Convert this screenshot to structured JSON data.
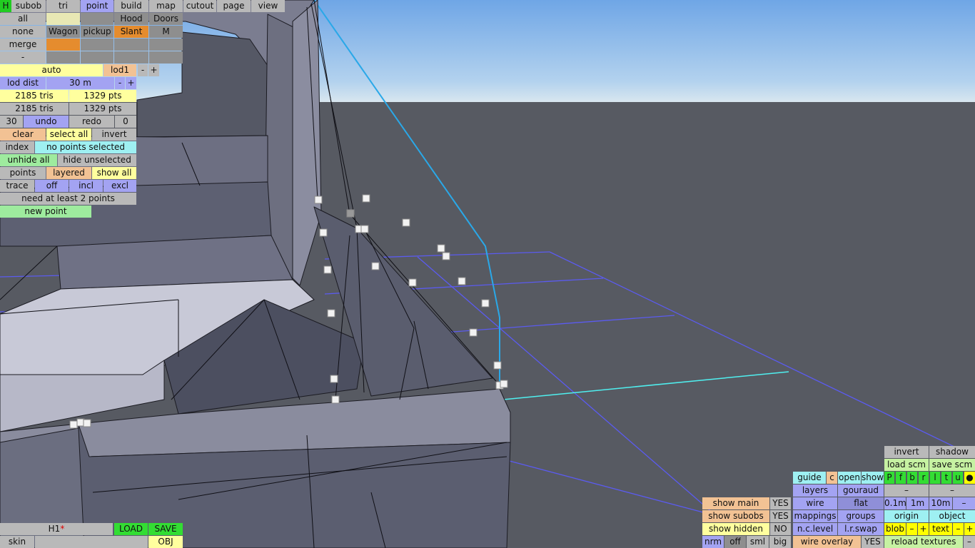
{
  "menu": {
    "h_button": "H",
    "tabs": [
      "subob",
      "tri",
      "point",
      "build",
      "map",
      "cutout",
      "page",
      "view"
    ],
    "active_tab": "point"
  },
  "selection_grid": {
    "row1": [
      "all",
      "",
      "",
      "Hood",
      "Doors"
    ],
    "row2": [
      "none",
      "Wagon",
      "pickup",
      "Slant",
      "M"
    ],
    "row3": [
      "merge",
      "",
      "",
      "",
      ""
    ],
    "row4": [
      "-",
      "",
      "",
      "",
      ""
    ]
  },
  "lod": {
    "mode": "auto",
    "level": "lod1",
    "minus": "-",
    "plus": "+",
    "dist_label": "lod dist",
    "dist_value": "30 m"
  },
  "stats": {
    "tris1": "2185 tris",
    "pts1": "1329 pts",
    "tris2": "2185 tris",
    "pts2": "1329 pts"
  },
  "undo": {
    "count": "30",
    "undo": "undo",
    "redo": "redo",
    "redo_count": "0"
  },
  "select_row": {
    "clear": "clear",
    "select_all": "select all",
    "invert": "invert"
  },
  "index_row": {
    "index": "index",
    "status": "no points selected"
  },
  "hide_row": {
    "unhide_all": "unhide all",
    "hide_unselected": "hide unselected"
  },
  "points_row": {
    "points": "points",
    "layered": "layered",
    "show_all": "show all"
  },
  "trace_row": {
    "trace": "trace",
    "off": "off",
    "incl": "incl",
    "excl": "excl"
  },
  "message": "need at least 2 points",
  "new_point": "new point",
  "bottom_left": {
    "model_name": "H1",
    "modified_mark": "*",
    "load": "LOAD",
    "save": "SAVE",
    "skin": "skin",
    "obj": "OBJ"
  },
  "show_panel": {
    "show_main": "show main",
    "show_main_val": "YES",
    "show_subobs": "show subobs",
    "show_subobs_val": "YES",
    "show_hidden": "show hidden",
    "show_hidden_val": "NO",
    "nrm": "nrm",
    "off": "off",
    "sml": "sml",
    "big": "big"
  },
  "render_panel": {
    "invert": "invert",
    "shadow": "shadow",
    "load_scm": "load scm",
    "save_scm": "save scm",
    "guide": "guide",
    "c": "c",
    "open": "open",
    "show": "show",
    "views": [
      "P",
      "f",
      "b",
      "r",
      "l",
      "t",
      "u",
      "●"
    ],
    "layers": "layers",
    "gouraud": "gouraud",
    "dash1": "–",
    "dash2": "–",
    "wire": "wire",
    "flat": "flat",
    "grid1": "0.1m",
    "grid2": "1m",
    "grid3": "10m",
    "grid_minus": "–",
    "mappings": "mappings",
    "groups": "groups",
    "origin": "origin",
    "object": "object",
    "nc_level": "n.c.level",
    "lr_swap": "l.r.swap",
    "blob": "blob",
    "blob_minus": "–",
    "blob_plus": "+",
    "text": "text",
    "text_minus": "–",
    "text_plus": "+",
    "wire_overlay": "wire overlay",
    "wire_overlay_val": "YES",
    "reload_textures": "reload textures",
    "reload_minus": "–"
  }
}
